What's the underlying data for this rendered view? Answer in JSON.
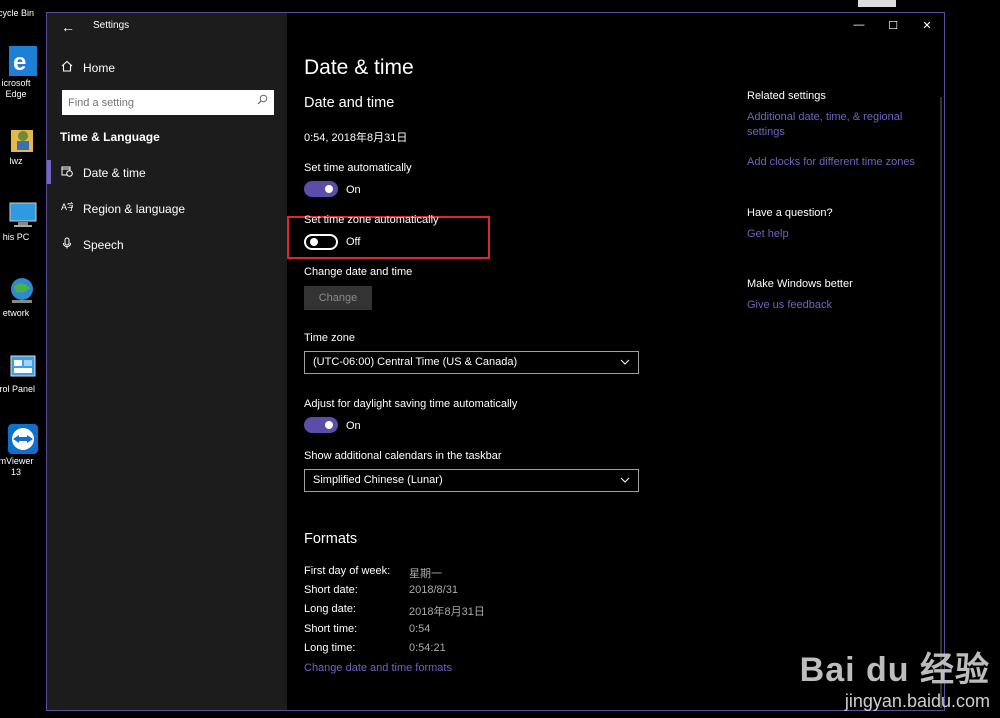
{
  "desktop": {
    "items": [
      {
        "label": "cycle Bin",
        "icon": "recycle-bin-icon"
      },
      {
        "label": "icrosoft\nEdge",
        "icon": "edge-icon"
      },
      {
        "label": "lwz",
        "icon": "user-folder-icon"
      },
      {
        "label": "his PC",
        "icon": "computer-icon"
      },
      {
        "label": "etwork",
        "icon": "network-icon"
      },
      {
        "label": "trol Panel",
        "icon": "control-panel-icon"
      },
      {
        "label": "mViewer\n13",
        "icon": "teamviewer-icon"
      }
    ]
  },
  "window": {
    "title": "Settings",
    "controls": {
      "minimize": "—",
      "maximize": "☐",
      "close": "✕"
    }
  },
  "sidebar": {
    "home_label": "Home",
    "search_placeholder": "Find a setting",
    "section": "Time & Language",
    "items": [
      {
        "label": "Date & time",
        "icon": "calendar-clock-icon",
        "active": true
      },
      {
        "label": "Region & language",
        "icon": "language-icon",
        "active": false
      },
      {
        "label": "Speech",
        "icon": "microphone-icon",
        "active": false
      }
    ]
  },
  "main": {
    "page_title": "Date & time",
    "section_title": "Date and time",
    "current_datetime": "0:54, 2018年8月31日",
    "set_time_auto": {
      "label": "Set time automatically",
      "state": "On",
      "value": true
    },
    "set_tz_auto": {
      "label": "Set time zone automatically",
      "state": "Off",
      "value": false
    },
    "change_dt": {
      "label": "Change date and time",
      "button": "Change"
    },
    "time_zone": {
      "label": "Time zone",
      "value": "(UTC-06:00) Central Time (US & Canada)"
    },
    "dst": {
      "label": "Adjust for daylight saving time automatically",
      "state": "On",
      "value": true
    },
    "calendars": {
      "label": "Show additional calendars in the taskbar",
      "value": "Simplified Chinese (Lunar)"
    },
    "formats": {
      "title": "Formats",
      "rows": [
        {
          "label": "First day of week:",
          "value": "星期一"
        },
        {
          "label": "Short date:",
          "value": "2018/8/31"
        },
        {
          "label": "Long date:",
          "value": "2018年8月31日"
        },
        {
          "label": "Short time:",
          "value": "0:54"
        },
        {
          "label": "Long time:",
          "value": "0:54:21"
        }
      ],
      "link": "Change date and time formats"
    }
  },
  "related": {
    "heading": "Related settings",
    "link1": "Additional date, time, & regional settings",
    "link2": "Add clocks for different time zones",
    "question_heading": "Have a question?",
    "help_link": "Get help",
    "better_heading": "Make Windows better",
    "feedback_link": "Give us feedback"
  },
  "watermark": {
    "main": "Bai du 经验",
    "sub": "jingyan.baidu.com"
  },
  "colors": {
    "accent": "#5c4ea8",
    "link": "#6c63c0",
    "highlight": "#e1262b",
    "window_border": "#5b4e99"
  }
}
